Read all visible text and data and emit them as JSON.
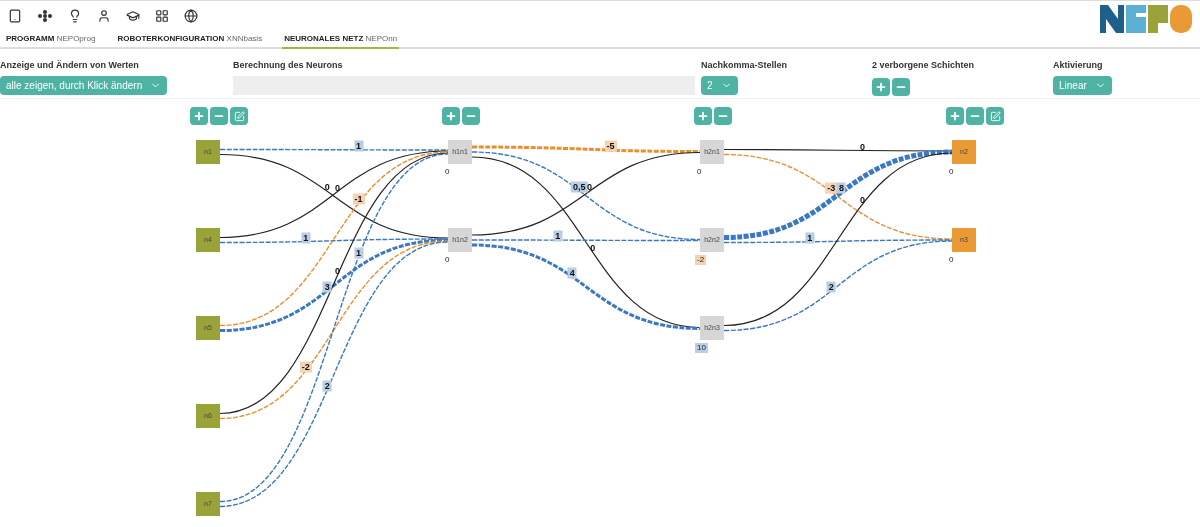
{
  "tabs": [
    {
      "title": "PROGRAMM",
      "subtitle": "NEPOprog",
      "selected": false
    },
    {
      "title": "ROBOTERKONFIGURATION",
      "subtitle": "XNNbasis",
      "selected": false
    },
    {
      "title": "NEURONALES NETZ",
      "subtitle": "NEPOnn",
      "selected": true
    }
  ],
  "controls": [
    {
      "kind": "select",
      "label": "Anzeige und Ändern von Werten",
      "value": "alle zeigen, durch Klick ändern"
    },
    {
      "kind": "field",
      "label": "Berechnung des Neurons"
    },
    {
      "kind": "select",
      "label": "Nachkomma-Stellen",
      "value": "2"
    },
    {
      "kind": "stepper",
      "label": "2 verborgene Schichten"
    },
    {
      "kind": "select",
      "label": "Aktivierung",
      "value": "Linear"
    }
  ],
  "layers": [
    {
      "kind": "input",
      "buttons": [
        {
          "kind": "add"
        },
        {
          "kind": "remove"
        },
        {
          "kind": "edit"
        }
      ],
      "nodes": [
        {
          "label": "n1",
          "edges": [
            {
              "weight": "1",
              "kind": "positive"
            },
            {
              "weight": "0",
              "kind": "zero"
            }
          ]
        },
        {
          "label": "n4",
          "edges": [
            {
              "weight": "0",
              "kind": "zero"
            },
            {
              "weight": "1",
              "kind": "positive"
            }
          ]
        },
        {
          "label": "n5",
          "edges": [
            {
              "weight": "-1",
              "kind": "negative"
            },
            {
              "weight": "3",
              "kind": "positive_medium"
            }
          ]
        },
        {
          "label": "n6",
          "edges": [
            {
              "weight": "0",
              "kind": "zero"
            },
            {
              "weight": "-2",
              "kind": "negative"
            }
          ]
        },
        {
          "label": "n7",
          "edges": [
            {
              "weight": "1",
              "kind": "positive"
            },
            {
              "weight": "2",
              "kind": "positive"
            }
          ]
        }
      ]
    },
    {
      "kind": "hidden",
      "buttons": [
        {
          "kind": "add"
        },
        {
          "kind": "remove"
        }
      ],
      "nodes": [
        {
          "label": "h1n1",
          "value": {
            "text": "0",
            "kind": "zero"
          },
          "edges": [
            {
              "weight": "-5",
              "kind": "negative_medium"
            },
            {
              "weight": "0,5",
              "kind": "positive"
            },
            {
              "weight": "0",
              "kind": "zero"
            }
          ]
        },
        {
          "label": "h1n2",
          "value": {
            "text": "0",
            "kind": "zero"
          },
          "edges": [
            {
              "weight": "0",
              "kind": "zero"
            },
            {
              "weight": "1",
              "kind": "positive"
            },
            {
              "weight": "4",
              "kind": "positive_medium"
            }
          ]
        }
      ]
    },
    {
      "kind": "hidden",
      "buttons": [
        {
          "kind": "add"
        },
        {
          "kind": "remove"
        }
      ],
      "nodes": [
        {
          "label": "h2n1",
          "value": {
            "text": "0",
            "kind": "zero"
          },
          "edges": [
            {
              "weight": "0",
              "kind": "zero"
            },
            {
              "weight": "-3",
              "kind": "negative"
            }
          ]
        },
        {
          "label": "h2n2",
          "value": {
            "text": "-2",
            "kind": "negative"
          },
          "edges": [
            {
              "weight": "8",
              "kind": "positive_thick"
            },
            {
              "weight": "1",
              "kind": "positive"
            }
          ]
        },
        {
          "label": "h2n3",
          "value": {
            "text": "10",
            "kind": "positive"
          },
          "edges": [
            {
              "weight": "0",
              "kind": "zero"
            },
            {
              "weight": "2",
              "kind": "positive"
            }
          ]
        }
      ]
    },
    {
      "kind": "output",
      "buttons": [
        {
          "kind": "add"
        },
        {
          "kind": "remove"
        },
        {
          "kind": "edit"
        }
      ],
      "nodes": [
        {
          "label": "n2",
          "value": {
            "text": "0",
            "kind": "zero"
          }
        },
        {
          "label": "n3",
          "value": {
            "text": "0",
            "kind": "zero"
          }
        }
      ]
    }
  ]
}
